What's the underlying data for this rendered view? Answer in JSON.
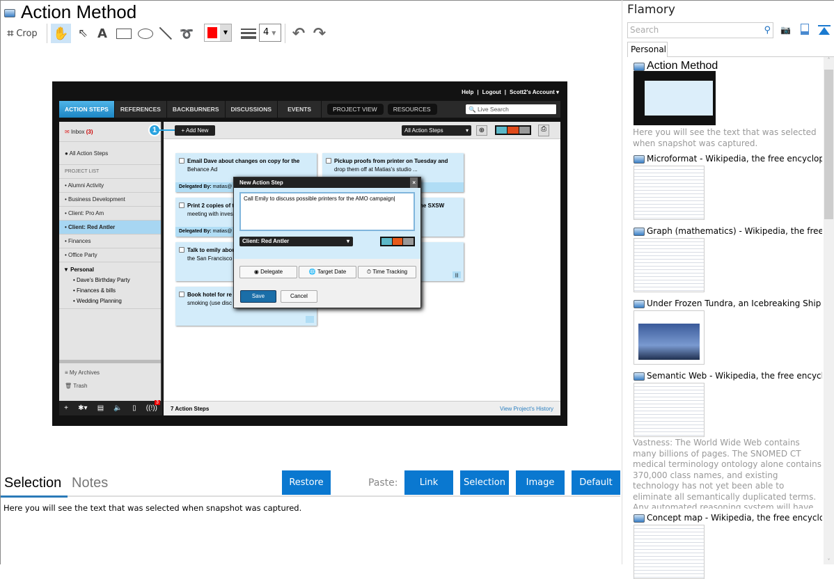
{
  "window": {
    "title": "Action Method"
  },
  "toolbar": {
    "crop": "Crop",
    "line_width": "4",
    "color": "#ff0000"
  },
  "screenshot": {
    "top_links": [
      "Help",
      "|",
      "Logout",
      "|",
      "Scott2's Account ▾"
    ],
    "nav": [
      "ACTION STEPS",
      "REFERENCES",
      "BACKBURNERS",
      "DISCUSSIONS",
      "EVENTS"
    ],
    "nav_pills": [
      "PROJECT VIEW",
      "RESOURCES"
    ],
    "search_placeholder": "Live Search",
    "inbox": "Inbox",
    "inbox_count": "(3)",
    "all_steps": "All Action Steps",
    "project_list_label": "PROJECT LIST",
    "projects": [
      "Alumni Activity",
      "Business Development",
      "Client: Pro Am",
      "Client: Red Antler",
      "Finances",
      "Office Party"
    ],
    "personal": "▼ Personal",
    "personal_items": [
      "Dave's Birthday Party",
      "Finances & bills",
      "Wedding Planning"
    ],
    "archives": "My Archives",
    "trash": "Trash",
    "alert_count": "3",
    "callout": "1",
    "add_new": "+ Add New",
    "filter": "All Action Steps",
    "cards": [
      {
        "bold": "Email Dave about changes on copy for the",
        "rest": "Behance Ad",
        "delegated": "Delegated By:",
        "by": "matias@"
      },
      {
        "bold": "Pickup proofs from printer on Tuesday and",
        "rest": "drop them off at Matias's studio ...",
        "delegated": "",
        "by": ""
      },
      {
        "bold": "Print 2 copies of t",
        "rest": "meeting with inves",
        "delegated": "Delegated By:",
        "by": "matias@"
      },
      {
        "bold": "ne SXSW",
        "rest": "",
        "delegated": "",
        "by": ""
      },
      {
        "bold": "Talk to emily abou",
        "rest": "the San Francisco",
        "delegated": "",
        "by": ""
      },
      {
        "bold": "",
        "rest": "",
        "delegated": "",
        "by": ""
      },
      {
        "bold": "Book hotel for re",
        "rest": "smoking (use disc",
        "delegated": "",
        "by": ""
      }
    ],
    "dialog": {
      "title": "New Action Step",
      "text": "Call Emily to discuss possible printers for the AMO campaign",
      "project": "Client: Red Antler",
      "delegate": "Delegate",
      "target": "Target Date",
      "time": "Time Tracking",
      "save": "Save",
      "cancel": "Cancel"
    },
    "footer_count": "7 Action Steps",
    "footer_link": "View Project's History"
  },
  "bottom": {
    "tab_selection": "Selection",
    "tab_notes": "Notes",
    "restore": "Restore",
    "paste": "Paste:",
    "link": "Link",
    "selection": "Selection",
    "image": "Image",
    "default": "Default",
    "text": "Here you will see the text that was selected when snapshot was captured."
  },
  "sidebar": {
    "title": "Flamory",
    "search_placeholder": "Search",
    "tab": "Personal",
    "items": [
      {
        "title": "Action Method",
        "desc": "Here you will see the text that was selected when snapshot was captured."
      },
      {
        "title": "Microformat - Wikipedia, the free encyclopedia",
        "desc": ""
      },
      {
        "title": "Graph (mathematics) - Wikipedia, the free encyclopedia",
        "desc": ""
      },
      {
        "title": "Under Frozen Tundra, an Icebreaking Ship Uncovers",
        "desc": ""
      },
      {
        "title": "Semantic Web - Wikipedia, the free encyclopedia",
        "desc": "Vastness: The World Wide Web contains many billions of pages. The SNOMED CT medical terminology ontology alone contains 370,000 class names, and existing technology has not yet been able to eliminate all semantically duplicated terms. Any automated reasoning system will have to deal with truly huge inputs."
      },
      {
        "title": "Concept map - Wikipedia, the free encyclopedia",
        "desc": ""
      }
    ]
  }
}
